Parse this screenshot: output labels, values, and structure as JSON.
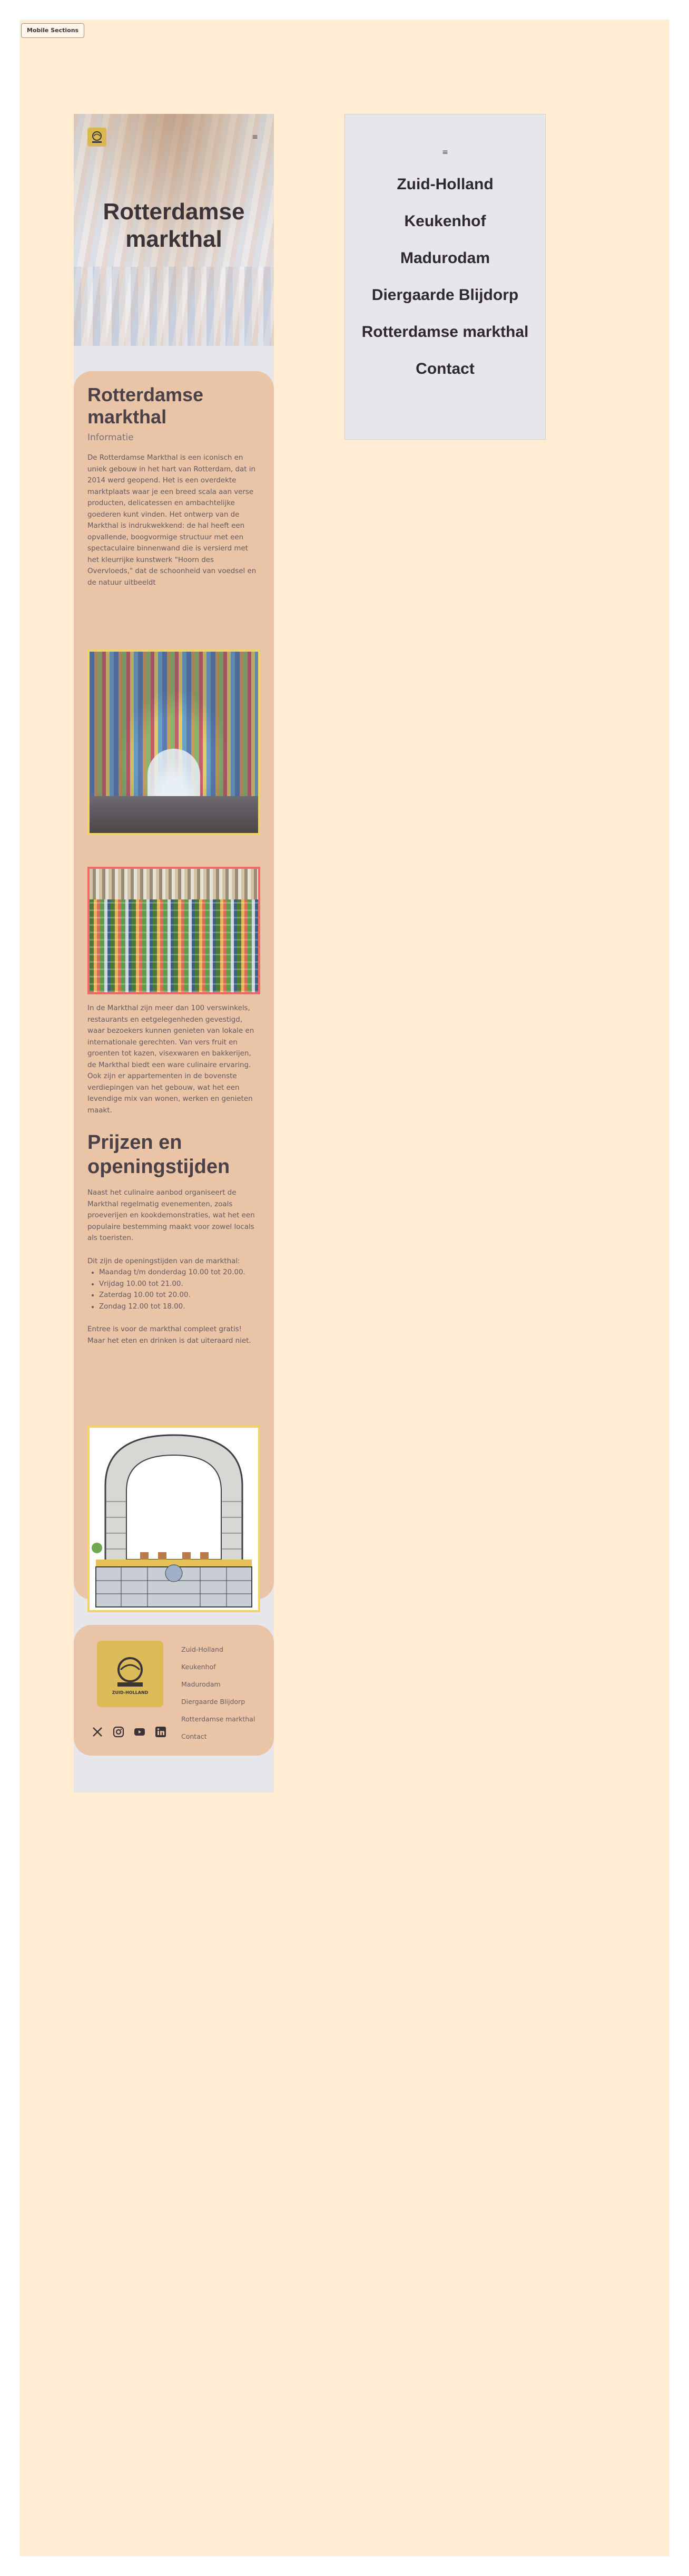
{
  "toolbar": {
    "mobile_sections_label": "Mobile Sections"
  },
  "hero": {
    "title": "Rotterdamse markthal",
    "menu_icon": "≡"
  },
  "logo": {
    "name": "Zuid-Holland",
    "label": "ZUID-HOLLAND"
  },
  "menu": {
    "close_icon": "≡",
    "items": [
      {
        "label": "Zuid-Holland"
      },
      {
        "label": "Keukenhof"
      },
      {
        "label": "Madurodam"
      },
      {
        "label": "Diergaarde Blijdorp"
      },
      {
        "label": "Rotterdamse markthal"
      },
      {
        "label": "Contact"
      }
    ]
  },
  "content": {
    "heading": "Rotterdamse markthal",
    "subheading": "Informatie",
    "intro": "De Rotterdamse Markthal is een iconisch en uniek gebouw in het hart van Rotterdam, dat in 2014 werd geopend. Het is een overdekte marktplaats waar je een breed scala aan verse producten, delicatessen en ambachtelijke goederen kunt vinden. Het ontwerp van de Markthal is indrukwekkend: de hal heeft een opvallende, boogvormige structuur met een spectaculaire binnenwand die is versierd met het kleurrijke kunstwerk \"Hoorn des Overvloeds,\" dat de schoonheid van voedsel en de natuur uitbeeldt",
    "middle": "In de Markthal zijn meer dan 100 verswinkels, restaurants en eetgelegenheden gevestigd, waar bezoekers kunnen genieten van lokale en internationale gerechten. Van vers fruit en groenten tot kazen, visexwaren en bakkerijen, de Markthal biedt een ware culinaire ervaring. Ook zijn er appartementen in de bovenste verdiepingen van het gebouw, wat het een levendige mix van wonen, werken en genieten maakt.",
    "prices_heading": "Prijzen en openingstijden",
    "events": "Naast het culinaire aanbod organiseert de Markthal regelmatig evenementen, zoals proeverijen en kookdemonstraties, wat het een populaire bestemming maakt voor zowel locals als toeristen.",
    "hours_intro": "Dit zijn de openingstijden van de markthal:",
    "hours": [
      "Maandag t/m donderdag 10.00 tot 20.00.",
      "Vrijdag 10.00 tot 21.00.",
      "Zaterdag 10.00 tot 20.00.",
      "Zondag 12.00 tot 18.00."
    ],
    "entry": "Entree is voor de markthal compleet gratis! Maar het eten en drinken is dat uiteraard niet."
  },
  "footer": {
    "links": [
      {
        "label": "Zuid-Holland"
      },
      {
        "label": "Keukenhof"
      },
      {
        "label": "Madurodam"
      },
      {
        "label": "Diergaarde Blijdorp"
      },
      {
        "label": "Rotterdamse markthal"
      },
      {
        "label": "Contact"
      }
    ],
    "socials": [
      "x-icon",
      "instagram-icon",
      "youtube-icon",
      "linkedin-icon"
    ]
  },
  "colors": {
    "canvas": "#ffecd2",
    "card": "#e9c4a7",
    "accent_yellow": "#f2d36a",
    "accent_red": "#ef6a64",
    "text": "#4a4047"
  }
}
